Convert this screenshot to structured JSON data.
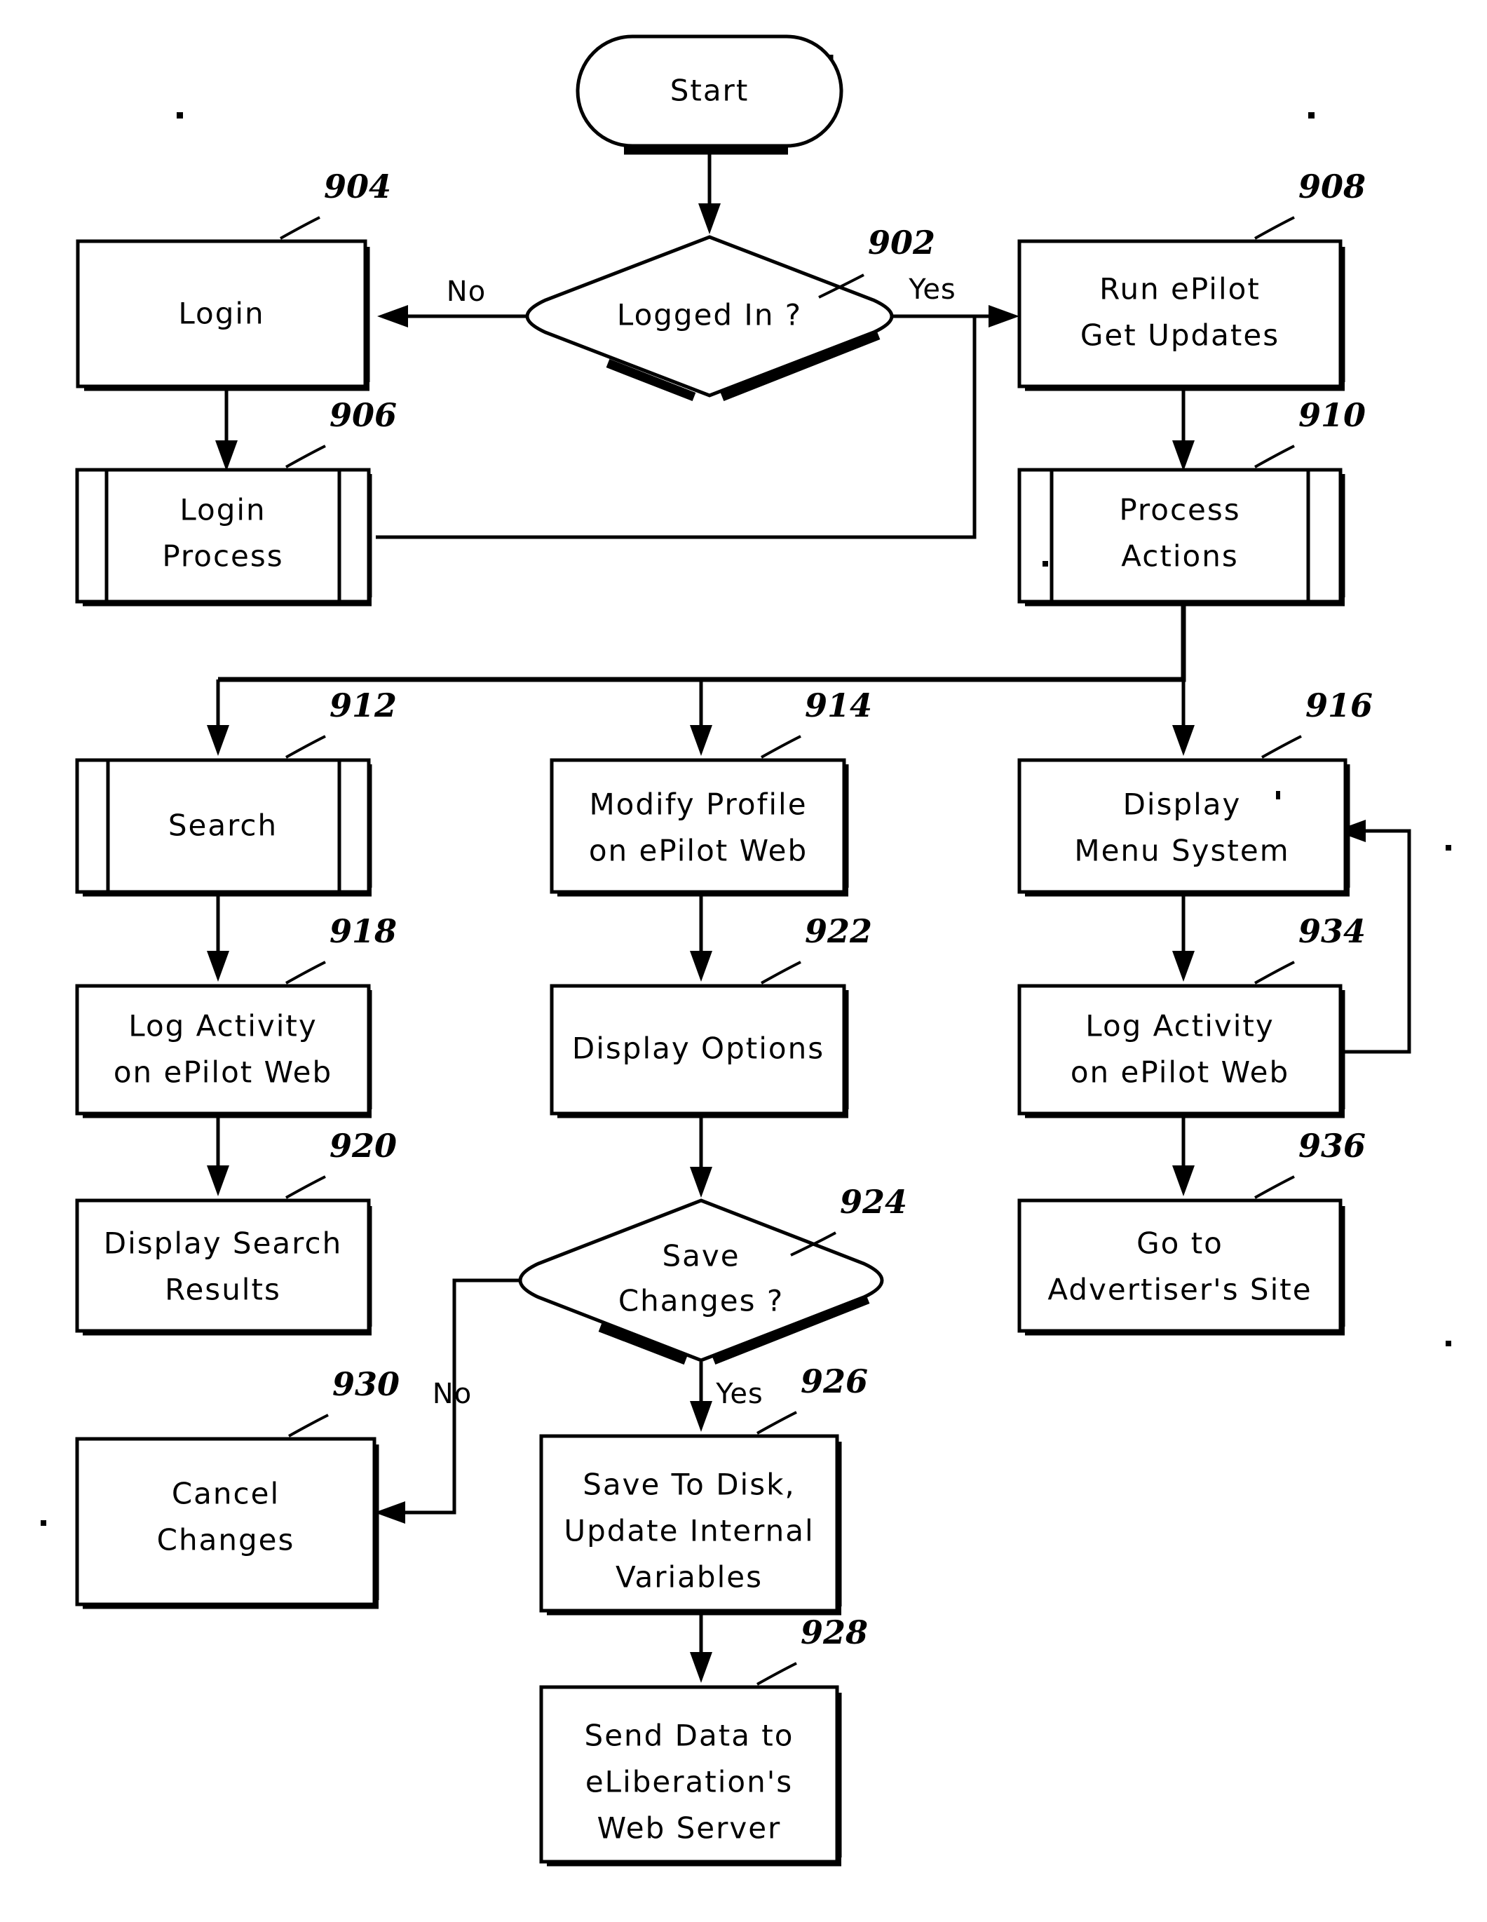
{
  "figure": {
    "kind": "patent-flowchart",
    "page_background": "#ffffff",
    "ink_color": "#000000"
  },
  "nodes": [
    {
      "id": "start",
      "ref": "",
      "shape": "terminator",
      "lines": [
        "Start"
      ]
    },
    {
      "id": "n902",
      "ref": "902",
      "shape": "decision",
      "lines": [
        "Logged In ?"
      ]
    },
    {
      "id": "n904",
      "ref": "904",
      "shape": "process",
      "lines": [
        "Login"
      ]
    },
    {
      "id": "n906",
      "ref": "906",
      "shape": "predefined-process",
      "lines": [
        "Login",
        "Process"
      ]
    },
    {
      "id": "n908",
      "ref": "908",
      "shape": "process",
      "lines": [
        "Run ePilot",
        "Get Updates"
      ]
    },
    {
      "id": "n910",
      "ref": "910",
      "shape": "predefined-process",
      "lines": [
        "Process",
        "Actions"
      ]
    },
    {
      "id": "n912",
      "ref": "912",
      "shape": "predefined-process",
      "lines": [
        "Search"
      ]
    },
    {
      "id": "n914",
      "ref": "914",
      "shape": "process",
      "lines": [
        "Modify Profile",
        "on ePilot Web"
      ]
    },
    {
      "id": "n916",
      "ref": "916",
      "shape": "process",
      "lines": [
        "Display",
        "Menu System"
      ]
    },
    {
      "id": "n918",
      "ref": "918",
      "shape": "process",
      "lines": [
        "Log Activity",
        "on ePilot Web"
      ]
    },
    {
      "id": "n920",
      "ref": "920",
      "shape": "process",
      "lines": [
        "Display Search",
        "Results"
      ]
    },
    {
      "id": "n922",
      "ref": "922",
      "shape": "process",
      "lines": [
        "Display Options"
      ]
    },
    {
      "id": "n924",
      "ref": "924",
      "shape": "decision",
      "lines": [
        "Save",
        "Changes ?"
      ]
    },
    {
      "id": "n926",
      "ref": "926",
      "shape": "process",
      "lines": [
        "Save To Disk,",
        "Update Internal",
        "Variables"
      ]
    },
    {
      "id": "n928",
      "ref": "928",
      "shape": "process",
      "lines": [
        "Send Data to",
        "eLiberation's",
        "Web Server"
      ]
    },
    {
      "id": "n930",
      "ref": "930",
      "shape": "process",
      "lines": [
        "Cancel",
        "Changes"
      ]
    },
    {
      "id": "n934",
      "ref": "934",
      "shape": "process",
      "lines": [
        "Log Activity",
        "on ePilot Web"
      ]
    },
    {
      "id": "n936",
      "ref": "936",
      "shape": "process",
      "lines": [
        "Go to",
        "Advertiser's Site"
      ]
    }
  ],
  "edge_labels": [
    {
      "id": "no-top",
      "text": "No"
    },
    {
      "id": "yes-top",
      "text": "Yes"
    },
    {
      "id": "no-save",
      "text": "No"
    },
    {
      "id": "yes-save",
      "text": "Yes"
    }
  ],
  "ref_numbers": [
    "902",
    "904",
    "906",
    "908",
    "910",
    "912",
    "914",
    "916",
    "918",
    "920",
    "922",
    "924",
    "926",
    "928",
    "930",
    "934",
    "936"
  ]
}
